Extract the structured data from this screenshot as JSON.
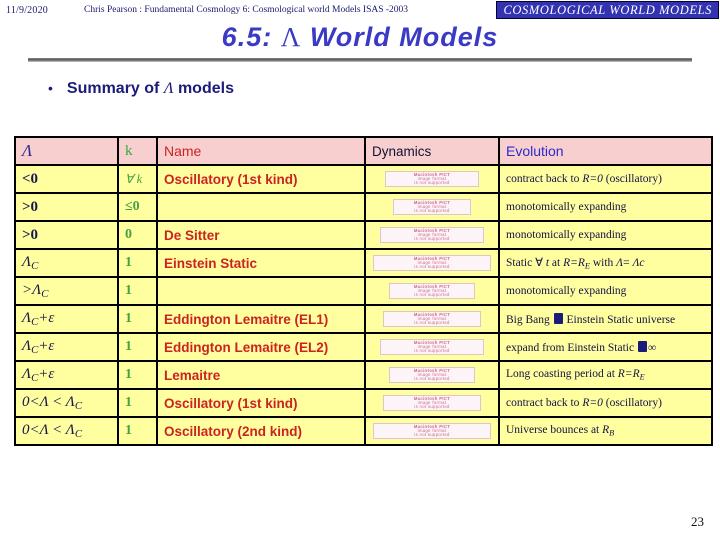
{
  "header": {
    "date": "11/9/2020",
    "center_text": "Chris Pearson : Fundamental Cosmology 6: Cosmological world Models  ISAS -2003",
    "banner": "COSMOLOGICAL WORLD MODELS"
  },
  "title": {
    "prefix": "6.5:",
    "lambda": "Λ",
    "suffix": "World Models"
  },
  "bullet": {
    "dot": "•",
    "text_before": "Summary of",
    "lambda": "Λ",
    "text_after": "models"
  },
  "table": {
    "columns": [
      {
        "key": "lambda",
        "label": "Λ"
      },
      {
        "key": "k",
        "label": "k"
      },
      {
        "key": "name",
        "label": "Name"
      },
      {
        "key": "dynamics",
        "label": "Dynamics"
      },
      {
        "key": "evolution",
        "label": "Evolution"
      }
    ],
    "pict_placeholder": {
      "line1": "Macintosh PICT",
      "line2": "image format",
      "line3": "is not supported"
    },
    "rows": [
      {
        "lambda": "<0",
        "k": "∀ k",
        "name": "Oscillatory (1st kind)",
        "dynamics": "pict-image",
        "evolution": "contract back to R=0 (oscillatory)"
      },
      {
        "lambda": ">0",
        "k": "≤0",
        "name": "",
        "dynamics": "pict-image",
        "evolution": "monotomically expanding"
      },
      {
        "lambda": ">0",
        "k": "0",
        "name": "De Sitter",
        "dynamics": "pict-image",
        "evolution": "monotomically expanding"
      },
      {
        "lambda": "ΛC",
        "k": "1",
        "name": "Einstein Static",
        "dynamics": "pict-image",
        "evolution": "Static ∀ t at R=RE with Λ= Λc"
      },
      {
        "lambda": ">ΛC",
        "k": "1",
        "name": "",
        "dynamics": "pict-image",
        "evolution": "monotomically expanding"
      },
      {
        "lambda": "ΛC+ε",
        "k": "1",
        "name": "Eddington Lemaitre (EL1)",
        "dynamics": "pict-image",
        "evolution": "Big Bang → Einstein Static universe"
      },
      {
        "lambda": "ΛC+ε",
        "k": "1",
        "name": "Eddington Lemaitre (EL2)",
        "dynamics": "pict-image",
        "evolution": "expand from Einstein Static →∞"
      },
      {
        "lambda": "ΛC+ε",
        "k": "1",
        "name": "Lemaitre",
        "dynamics": "pict-image",
        "evolution": "Long coasting period at R=RE"
      },
      {
        "lambda": "0<Λ < ΛC",
        "k": "1",
        "name": "Oscillatory (1st kind)",
        "dynamics": "pict-image",
        "evolution": "contract back to R=0 (oscillatory)"
      },
      {
        "lambda": "0<Λ < ΛC",
        "k": "1",
        "name": "Oscillatory (2nd kind)",
        "dynamics": "pict-image",
        "evolution": "Universe bounces at RB"
      }
    ]
  },
  "footer": {
    "page_number": "23"
  },
  "colors": {
    "banner_bg": "#3333b2",
    "title_blue": "#3a3ac4",
    "header_row_pink": "#f8cfcf",
    "body_row_yellow": "#ffffa0",
    "name_red": "#cc2222",
    "k_green": "#44a044",
    "evolution_blue": "#2a2ad0"
  }
}
